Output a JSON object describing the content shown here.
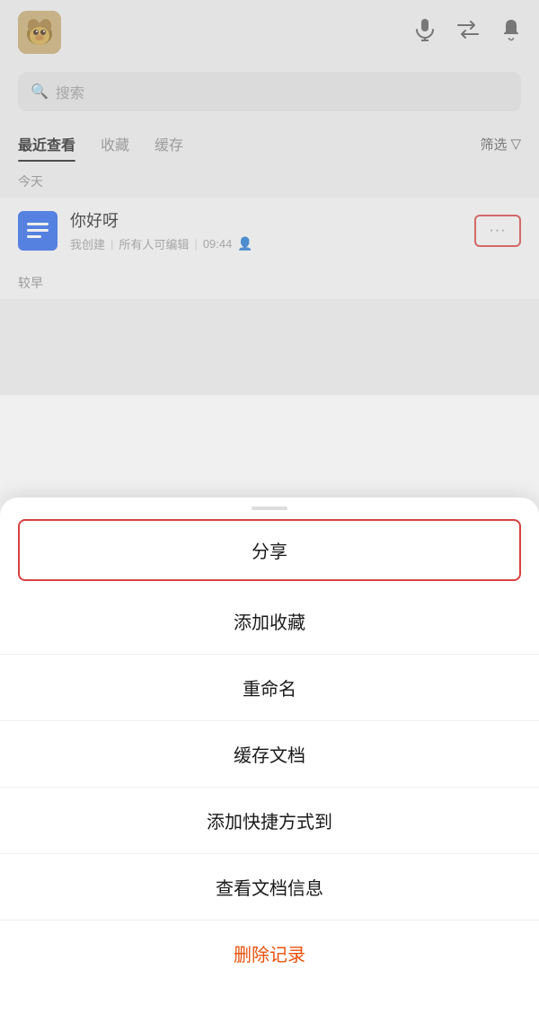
{
  "header": {
    "avatar_alt": "dog avatar"
  },
  "topIcons": {
    "mic_label": "🎤",
    "switch_label": "⇄",
    "bell_label": "🔔"
  },
  "search": {
    "placeholder": "搜索",
    "icon": "🔍"
  },
  "tabs": [
    {
      "label": "最近查看",
      "active": true
    },
    {
      "label": "收藏",
      "active": false
    },
    {
      "label": "缓存",
      "active": false
    }
  ],
  "filter": {
    "label": "筛选",
    "icon": "▽"
  },
  "sections": {
    "today": "今天",
    "earlier": "较早"
  },
  "document": {
    "title": "你好呀",
    "meta_created": "我创建",
    "meta_editable": "所有人可编辑",
    "meta_time": "09:44",
    "more_dots": "···"
  },
  "menu": {
    "share": "分享",
    "add_favorite": "添加收藏",
    "rename": "重命名",
    "cache_doc": "缓存文档",
    "add_shortcut": "添加快捷方式到",
    "view_info": "查看文档信息",
    "delete": "删除记录"
  }
}
